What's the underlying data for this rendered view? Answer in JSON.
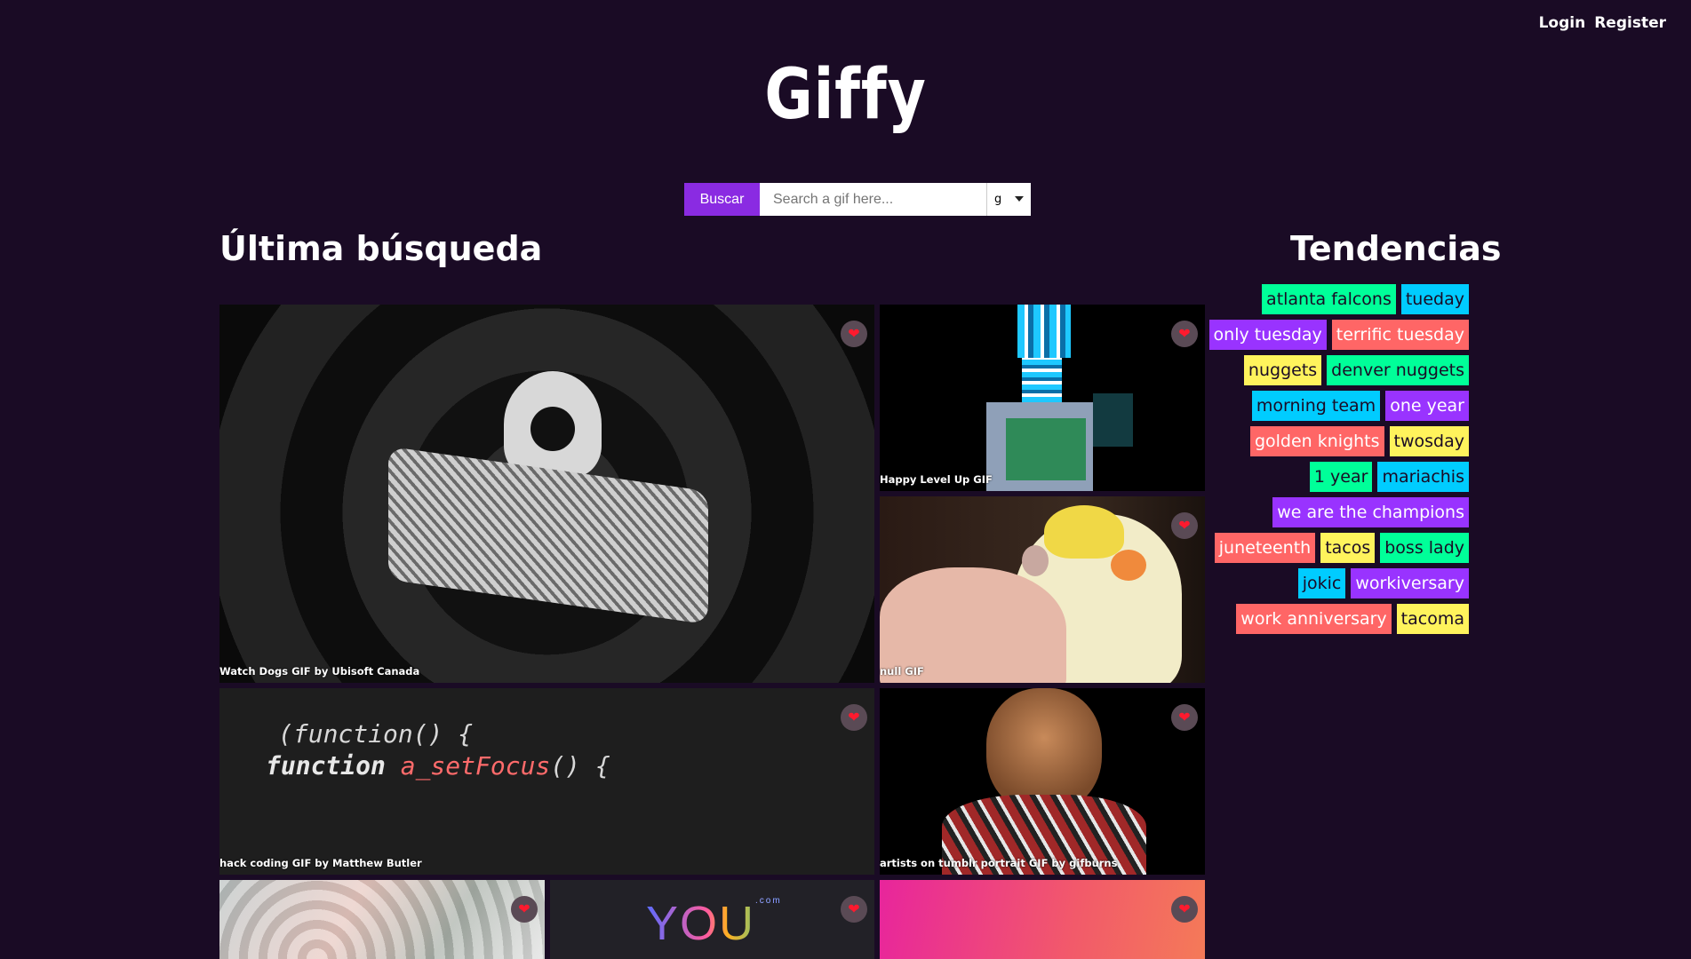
{
  "header": {
    "login": "Login",
    "register": "Register",
    "logo": "Giffy"
  },
  "search": {
    "button": "Buscar",
    "placeholder": "Search a gif here...",
    "rating": "g"
  },
  "sections": {
    "last_search": "Última búsqueda",
    "trending": "Tendencias"
  },
  "gifs": [
    {
      "title": "Watch Dogs GIF by Ubisoft Canada"
    },
    {
      "title": "Happy Level Up GIF"
    },
    {
      "title": "null GIF"
    },
    {
      "title": "hack coding GIF by Matthew Butler",
      "code_line1": "(function() {",
      "code_line2_a": "function ",
      "code_line2_b": "a_setFocus",
      "code_line2_c": "() {"
    },
    {
      "title": "artists on tumblr portrait GIF by gifburns"
    },
    {
      "title": ""
    },
    {
      "title": "",
      "logo_text": "YOU",
      "logo_sub": ".com"
    },
    {
      "title": ""
    }
  ],
  "trending": [
    [
      {
        "label": "atlanta falcons",
        "color": "green"
      },
      {
        "label": "tueday",
        "color": "blue"
      }
    ],
    [
      {
        "label": "only tuesday",
        "color": "purple"
      },
      {
        "label": "terrific tuesday",
        "color": "red"
      }
    ],
    [
      {
        "label": "nuggets",
        "color": "yellow"
      },
      {
        "label": "denver nuggets",
        "color": "green"
      }
    ],
    [
      {
        "label": "morning team",
        "color": "blue"
      },
      {
        "label": "one year",
        "color": "purple"
      }
    ],
    [
      {
        "label": "golden knights",
        "color": "red"
      },
      {
        "label": "twosday",
        "color": "yellow"
      }
    ],
    [
      {
        "label": "1 year",
        "color": "green"
      },
      {
        "label": "mariachis",
        "color": "blue"
      }
    ],
    [
      {
        "label": "we are the champions",
        "color": "purple"
      }
    ],
    [
      {
        "label": "juneteenth",
        "color": "red"
      },
      {
        "label": "tacos",
        "color": "yellow"
      },
      {
        "label": "boss lady",
        "color": "green"
      }
    ],
    [
      {
        "label": "jokic",
        "color": "blue"
      },
      {
        "label": "workiversary",
        "color": "purple"
      }
    ],
    [
      {
        "label": "work anniversary",
        "color": "red"
      },
      {
        "label": "tacoma",
        "color": "yellow"
      }
    ]
  ]
}
